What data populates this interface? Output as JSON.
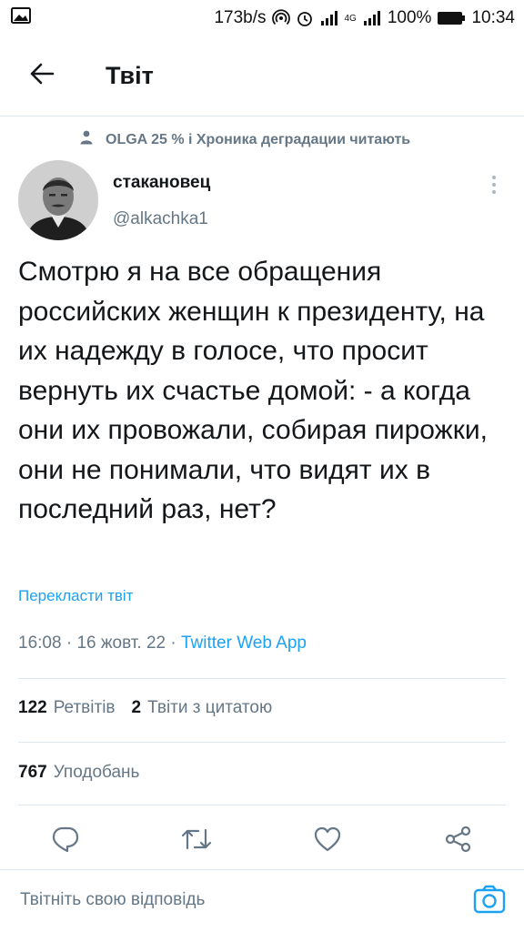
{
  "status_bar": {
    "speed": "173b/s",
    "network": "4G",
    "battery": "100%",
    "time": "10:34",
    "icons": [
      "image-icon",
      "hotspot-icon",
      "alarm-icon",
      "signal-icon",
      "battery-icon"
    ]
  },
  "header": {
    "title": "Твіт",
    "back_icon": "arrow-left-icon"
  },
  "social_context": {
    "text": "OLGA 25 % і Хроника деградации читають",
    "icon": "person-icon"
  },
  "tweet": {
    "author_name": "стакановец",
    "author_handle": "@alkachka1",
    "text": "Смотрю я на все обращения российских женщин к президенту, на их надежду в голосе, что просит вернуть их счастье домой: - а когда они их провожали, собирая пирожки, они не понимали, что видят их в последний раз, нет?",
    "translate_label": "Перекласти твіт",
    "time": "16:08",
    "separator": "·",
    "date": "16 жовт. 22",
    "source": "Twitter Web App"
  },
  "stats": {
    "retweets_count": "122",
    "retweets_label": "Ретвітів",
    "quotes_count": "2",
    "quotes_label": "Твіти з цитатою",
    "likes_count": "767",
    "likes_label": "Уподобань"
  },
  "actions": [
    "reply-icon",
    "retweet-icon",
    "like-icon",
    "share-icon"
  ],
  "reply_bar": {
    "placeholder": "Твітніть свою відповідь",
    "camera_icon": "camera-icon"
  },
  "colors": {
    "accent": "#1da1f2",
    "text_primary": "#14171a",
    "text_secondary": "#657786",
    "divider": "#e1e8ed"
  }
}
